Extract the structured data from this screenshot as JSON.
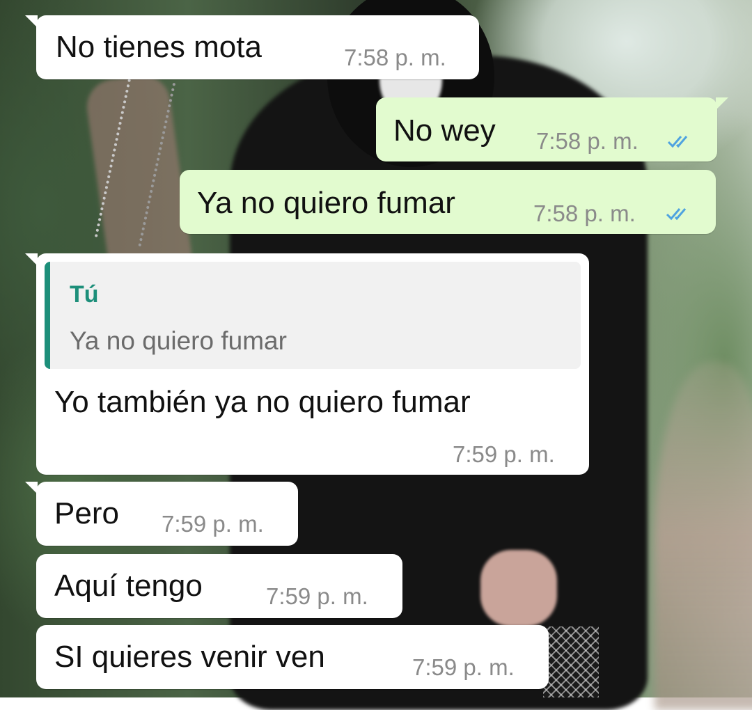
{
  "messages": [
    {
      "direction": "incoming",
      "text": "No tienes mota",
      "time": "7:58 p. m."
    },
    {
      "direction": "outgoing",
      "text": "No wey",
      "time": "7:58 p. m.",
      "status_icon": "double-check-read-icon"
    },
    {
      "direction": "outgoing",
      "text": "Ya no quiero fumar",
      "time": "7:58 p. m.",
      "status_icon": "double-check-read-icon"
    },
    {
      "direction": "incoming",
      "quote": {
        "author": "Tú",
        "text": "Ya no quiero fumar"
      },
      "text": "Yo también ya no quiero fumar",
      "time": "7:59 p. m."
    },
    {
      "direction": "incoming",
      "text": "Pero",
      "time": "7:59 p. m."
    },
    {
      "direction": "incoming",
      "text": "Aquí tengo",
      "time": "7:59 p. m."
    },
    {
      "direction": "incoming",
      "text": "SI quieres venir ven",
      "time": "7:59 p. m."
    }
  ],
  "colors": {
    "incoming_bubble": "#ffffff",
    "outgoing_bubble": "#e2fbcf",
    "quote_accent": "#1d8f7a",
    "read_ticks": "#4fa3e0",
    "timestamp": "#8a8a8a"
  }
}
